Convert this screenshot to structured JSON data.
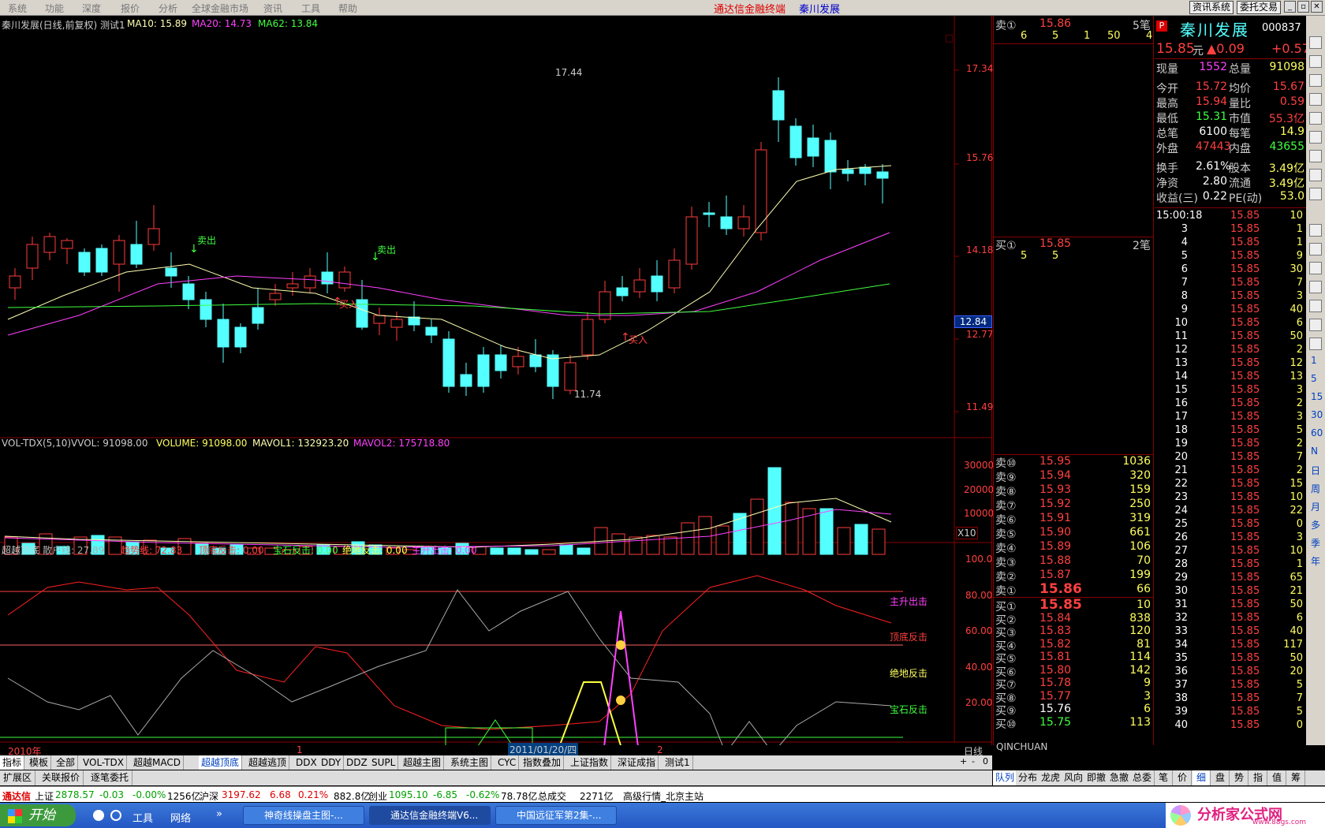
{
  "menu": [
    "系统",
    "功能",
    "深度",
    "报价",
    "分析",
    "全球金融市场",
    "资讯",
    "工具",
    "帮助"
  ],
  "app_title": "通达信金融终端",
  "stock_title": "秦川发展",
  "top_buttons": [
    "资讯系统",
    "委托交易"
  ],
  "main_header": {
    "name": "秦川发展(日线,前复权) 测试1",
    "ma10": "MA10: 15.89",
    "ma20": "MA20: 14.73",
    "ma62": "MA62: 13.84"
  },
  "price_axis": [
    "17.34",
    "15.76",
    "14.18",
    "12.77",
    "11.49"
  ],
  "price_tag": "12.84",
  "annotations": {
    "high": "17.44",
    "low": "11.74",
    "sell": "卖出",
    "buy": "买入"
  },
  "vol_header": {
    "name": "VOL-TDX(5,10)",
    "vvol": "VVOL: 91098.00",
    "volume": "VOLUME: 91098.00",
    "mavol1": "MAVOL1: 132923.20",
    "mavol2": "MAVOL2: 175718.80"
  },
  "vol_axis": [
    "30000",
    "20000",
    "10000"
  ],
  "vol_unit": "X10",
  "ind_header": {
    "name": "超越顶底",
    "a": "散户线: 27.89",
    "b": "趋势线: 72.83",
    "c": "顶底反击: 0.00",
    "d": "宝石反击: 0.00",
    "e": "绝地反击: 0.00",
    "f": "主升出击: 0.00"
  },
  "ind_axis": [
    "100.0",
    "80.00",
    "60.00",
    "40.00",
    "20.00"
  ],
  "ind_labels": [
    "主升出击",
    "顶底反击",
    "绝地反击",
    "宝石反击"
  ],
  "time_axis": {
    "y": "2010年",
    "m1": "1",
    "date": "2011/01/20/四",
    "m2": "2",
    "period": "日线"
  },
  "bottom_tabs": [
    "指标",
    "模板",
    "全部",
    "VOL-TDX",
    "超越MACD",
    "超越顶底",
    "超越逃顶",
    "DDX",
    "DDY",
    "DDZ",
    "SUPL",
    "超越主图",
    "系统主图",
    "CYC",
    "指数叠加",
    "上证指数",
    "深证成指",
    "测试1"
  ],
  "bottom_tabs2": [
    "扩展区",
    "关联报价",
    "逐笔委托"
  ],
  "book_top": {
    "sell1": "卖①",
    "sell1p": "15.86",
    "sell1c": "5笔",
    "sell1q": [
      "6",
      "5",
      "1",
      "50",
      "4"
    ],
    "buy1": "买①",
    "buy1p": "15.85",
    "buy1c": "2笔",
    "buy1q": [
      "5",
      "5"
    ]
  },
  "asks": [
    [
      "卖⑩",
      "15.95",
      "1036"
    ],
    [
      "卖⑨",
      "15.94",
      "320"
    ],
    [
      "卖⑧",
      "15.93",
      "159"
    ],
    [
      "卖⑦",
      "15.92",
      "250"
    ],
    [
      "卖⑥",
      "15.91",
      "319"
    ],
    [
      "卖⑤",
      "15.90",
      "661"
    ],
    [
      "卖④",
      "15.89",
      "106"
    ],
    [
      "卖③",
      "15.88",
      "70"
    ],
    [
      "卖②",
      "15.87",
      "199"
    ],
    [
      "卖①",
      "15.86",
      "66"
    ]
  ],
  "bids": [
    [
      "买①",
      "15.85",
      "10"
    ],
    [
      "买②",
      "15.84",
      "838"
    ],
    [
      "买③",
      "15.83",
      "120"
    ],
    [
      "买④",
      "15.82",
      "81"
    ],
    [
      "买⑤",
      "15.81",
      "114"
    ],
    [
      "买⑥",
      "15.80",
      "142"
    ],
    [
      "买⑦",
      "15.78",
      "9"
    ],
    [
      "买⑧",
      "15.77",
      "3"
    ],
    [
      "买⑨",
      "15.76",
      "6"
    ],
    [
      "买⑩",
      "15.75",
      "113"
    ]
  ],
  "book_footer": "QINCHUAN",
  "book_tabs": [
    "队列",
    "分布",
    "龙虎",
    "风向",
    "即撤",
    "急撤",
    "总委"
  ],
  "quote": {
    "name": "秦川发展",
    "code": "000837",
    "price": "15.85",
    "unit": "元",
    "chg": "▲0.09",
    "chgpct": "+0.57",
    "rows": [
      [
        "现量",
        "1552",
        "总量",
        "91098"
      ],
      [
        "今开",
        "15.72",
        "均价",
        "15.67"
      ],
      [
        "最高",
        "15.94",
        "量比",
        "0.59"
      ],
      [
        "最低",
        "15.31",
        "市值",
        "55.3亿"
      ],
      [
        "总笔",
        "6100",
        "每笔",
        "14.9"
      ],
      [
        "外盘",
        "47443",
        "内盘",
        "43655"
      ],
      [
        "换手",
        "2.61%",
        "股本",
        "3.49亿"
      ],
      [
        "净资",
        "2.80",
        "流通",
        "3.49亿"
      ],
      [
        "收益(三)",
        "0.22",
        "PE(动)",
        "53.0"
      ]
    ]
  },
  "ticks_first": "15:00:18",
  "ticks": [
    [
      "15:00:18",
      "15.85",
      "10"
    ],
    [
      "3",
      "15.85",
      "1"
    ],
    [
      "4",
      "15.85",
      "1"
    ],
    [
      "5",
      "15.85",
      "9"
    ],
    [
      "6",
      "15.85",
      "30"
    ],
    [
      "7",
      "15.85",
      "7"
    ],
    [
      "8",
      "15.85",
      "3"
    ],
    [
      "9",
      "15.85",
      "40"
    ],
    [
      "10",
      "15.85",
      "6"
    ],
    [
      "11",
      "15.85",
      "50"
    ],
    [
      "12",
      "15.85",
      "2"
    ],
    [
      "13",
      "15.85",
      "12"
    ],
    [
      "14",
      "15.85",
      "13"
    ],
    [
      "15",
      "15.85",
      "3"
    ],
    [
      "16",
      "15.85",
      "2"
    ],
    [
      "17",
      "15.85",
      "3"
    ],
    [
      "18",
      "15.85",
      "5"
    ],
    [
      "19",
      "15.85",
      "2"
    ],
    [
      "20",
      "15.85",
      "7"
    ],
    [
      "21",
      "15.85",
      "2"
    ],
    [
      "22",
      "15.85",
      "15"
    ],
    [
      "23",
      "15.85",
      "10"
    ],
    [
      "24",
      "15.85",
      "22"
    ],
    [
      "25",
      "15.85",
      "0"
    ],
    [
      "26",
      "15.85",
      "3"
    ],
    [
      "27",
      "15.85",
      "10"
    ],
    [
      "28",
      "15.85",
      "1"
    ],
    [
      "29",
      "15.85",
      "65"
    ],
    [
      "30",
      "15.85",
      "21"
    ],
    [
      "31",
      "15.85",
      "50"
    ],
    [
      "32",
      "15.85",
      "6"
    ],
    [
      "33",
      "15.85",
      "40"
    ],
    [
      "34",
      "15.85",
      "117"
    ],
    [
      "35",
      "15.85",
      "50"
    ],
    [
      "36",
      "15.85",
      "20"
    ],
    [
      "37",
      "15.85",
      "5"
    ],
    [
      "38",
      "15.85",
      "7"
    ],
    [
      "39",
      "15.85",
      "5"
    ],
    [
      "40",
      "15.85",
      "0"
    ]
  ],
  "quote_tabs": [
    "笔",
    "价",
    "细",
    "盘",
    "势",
    "指",
    "值",
    "筹"
  ],
  "rtools": [
    "1",
    "5",
    "15",
    "30",
    "60",
    "N",
    "日",
    "周",
    "月",
    "多",
    "季",
    "年"
  ],
  "status": {
    "brand": "通达信",
    "sh": "上证",
    "shv": "2878.57",
    "shc": "-0.03",
    "shp": "-0.00%",
    "sha": "1256亿",
    "sz": "沪深",
    "szv": "3197.62",
    "szc": "6.68",
    "szp": "0.21%",
    "sza": "882.8亿",
    "cy": "创业",
    "cyv": "1095.10",
    "cyc": "-6.85",
    "cyp": "-0.62%",
    "cya": "78.78亿",
    "tot": "总成交",
    "tota": "2271亿",
    "srv": "高级行情_北京主站"
  },
  "taskbar": {
    "start": "开始",
    "tool": "工具",
    "net": "网络",
    "t1": "神奇线操盘主图-...",
    "t2": "通达信金融终端V6...",
    "t3": "中国远征军第2集-...",
    "logo": "分析家公式网",
    "url": "www.88gs.com"
  },
  "colors": {
    "up": "#ff3c3c",
    "down": "#54ffff",
    "ma10": "#ffffb0",
    "ma20": "#ff40ff",
    "ma62": "#40ff40"
  }
}
